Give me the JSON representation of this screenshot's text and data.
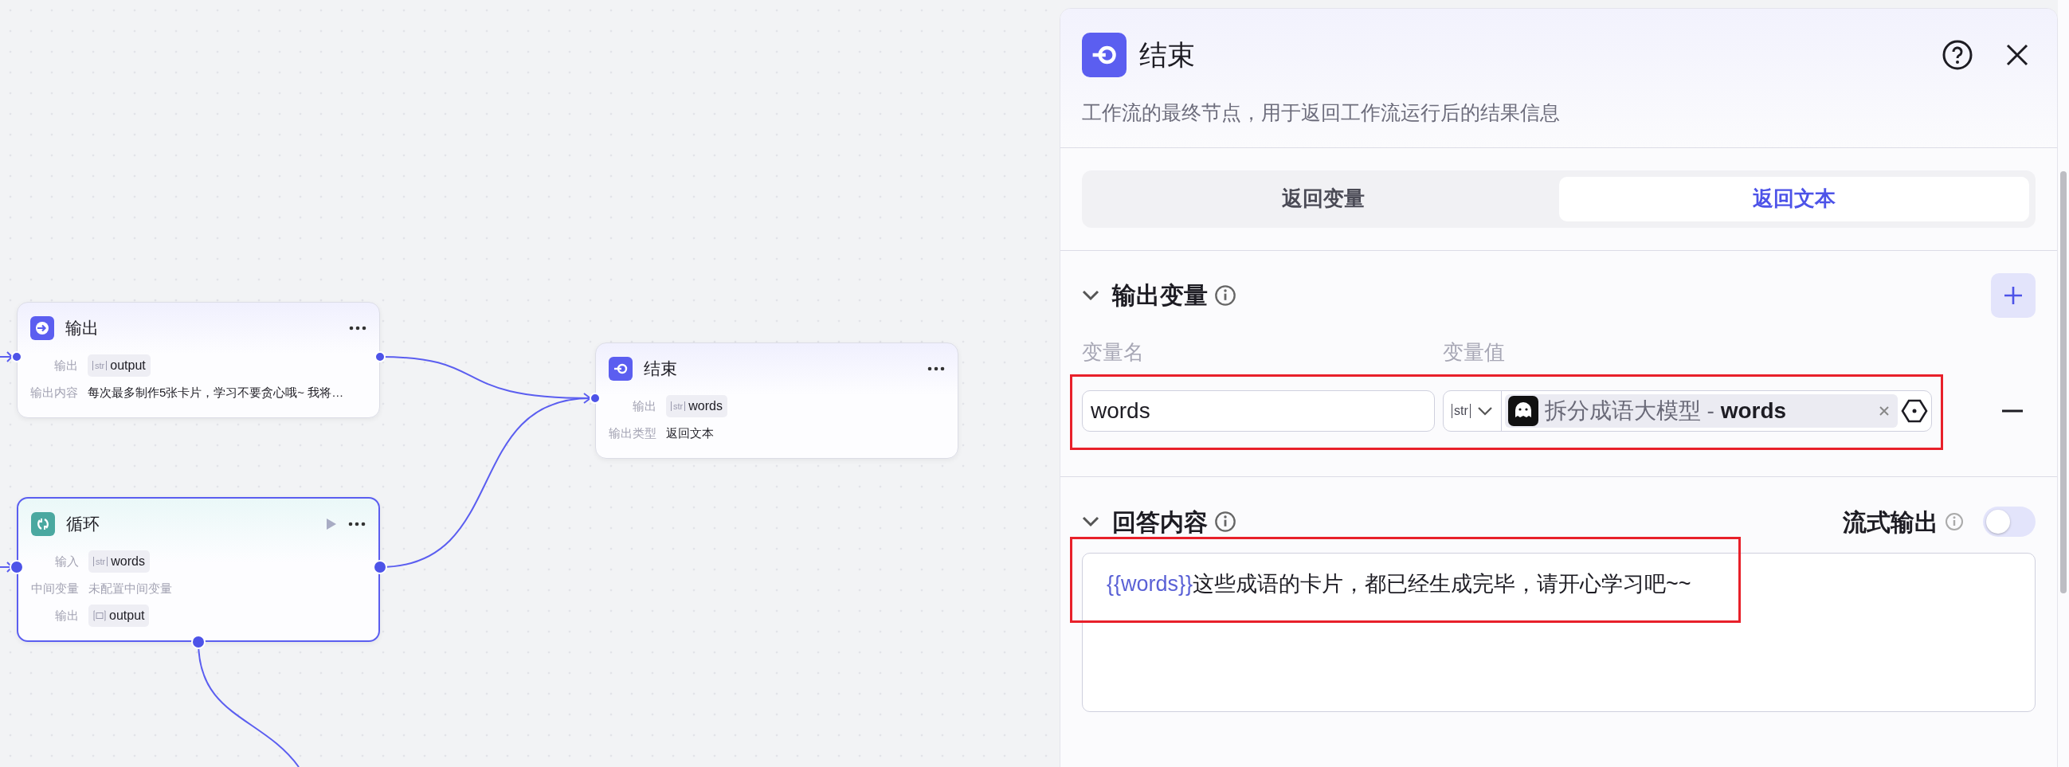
{
  "canvas": {
    "nodes": [
      {
        "kind": "output",
        "title": "输出",
        "selected": false,
        "run_button": false,
        "rows": [
          {
            "label": "输出",
            "chip": {
              "kind": "str",
              "type_label": "str",
              "name": "output"
            }
          },
          {
            "label": "输出内容",
            "text": "每次最多制作5张卡片，学习不要贪心哦~ 我将…"
          }
        ]
      },
      {
        "kind": "loop",
        "title": "循环",
        "selected": true,
        "run_button": true,
        "rows": [
          {
            "label": "输入",
            "chip": {
              "kind": "str",
              "type_label": "str",
              "name": "words"
            }
          },
          {
            "label": "中间变量",
            "text": "未配置中间变量",
            "muted": true
          },
          {
            "label": "输出",
            "chip": {
              "kind": "array",
              "name": "output"
            }
          }
        ]
      },
      {
        "kind": "end",
        "title": "结束",
        "selected": false,
        "run_button": false,
        "rows": [
          {
            "label": "输出",
            "chip": {
              "kind": "str",
              "type_label": "str",
              "name": "words"
            }
          },
          {
            "label": "输出类型",
            "text": "返回文本"
          }
        ]
      }
    ]
  },
  "panel": {
    "title": "结束",
    "description": "工作流的最终节点，用于返回工作流运行后的结果信息",
    "tabs": [
      {
        "label": "返回变量",
        "selected": false
      },
      {
        "label": "返回文本",
        "selected": true
      }
    ],
    "output_variables": {
      "title": "输出变量",
      "expanded": true,
      "name_header": "变量名",
      "value_header": "变量值",
      "rows": [
        {
          "name": "words",
          "type_label": "str",
          "source_node": "拆分成语大模型",
          "separator": "-",
          "source_var": "words",
          "highlighted": true
        }
      ]
    },
    "answer": {
      "title": "回答内容",
      "expanded": true,
      "stream_label": "流式输出",
      "stream_on": false,
      "variable_ref": "{{words}}",
      "text": "这些成语的卡片，都已经生成完毕，请开心学习吧~~",
      "highlighted": true
    }
  }
}
